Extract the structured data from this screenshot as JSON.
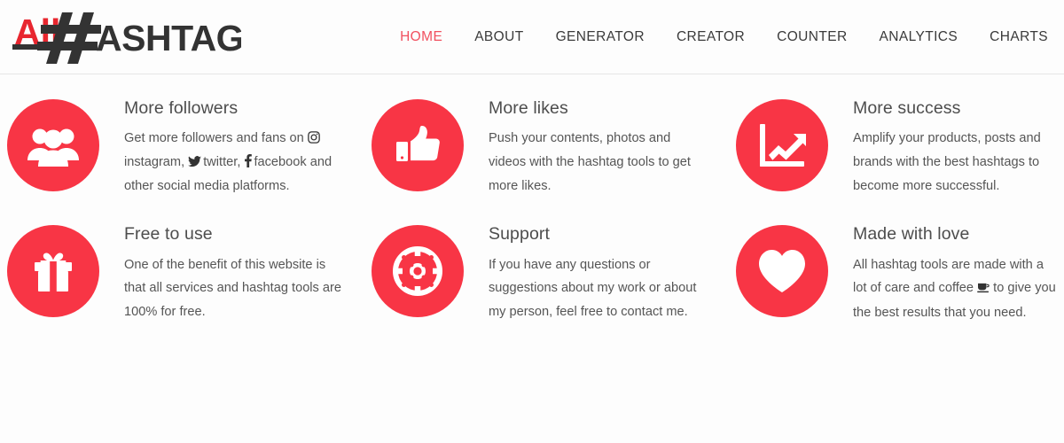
{
  "header": {
    "logo": {
      "name": "AllHashtag",
      "part_red": "All",
      "part_hash": "#",
      "part_dark": "ASHTAG"
    },
    "nav": [
      {
        "label": "HOME",
        "active": true
      },
      {
        "label": "ABOUT",
        "active": false
      },
      {
        "label": "GENERATOR",
        "active": false
      },
      {
        "label": "CREATOR",
        "active": false
      },
      {
        "label": "COUNTER",
        "active": false
      },
      {
        "label": "ANALYTICS",
        "active": false
      },
      {
        "label": "CHARTS",
        "active": false
      }
    ]
  },
  "colors": {
    "accent_red": "#f83545",
    "nav_active": "#f1505f",
    "logo_red": "#e8262f",
    "logo_dark": "#333333",
    "title_text": "#4d4d4d",
    "body_text": "#555555",
    "page_background": "#fdfdfd",
    "header_border": "#e6e6e6"
  },
  "features": [
    {
      "icon": "people-group-icon",
      "title": "More followers",
      "text_before": "Get more followers and fans on ",
      "inline_items": [
        {
          "icon": "instagram-icon",
          "label": "instagram,"
        },
        {
          "icon": "twitter-icon",
          "label": "twitter,"
        },
        {
          "icon": "facebook-icon",
          "label": "facebook"
        }
      ],
      "text_after": " and other social media platforms."
    },
    {
      "icon": "thumbs-up-icon",
      "title": "More likes",
      "text": "Push your contents, photos and videos with the hashtag tools to get more likes."
    },
    {
      "icon": "chart-growth-icon",
      "title": "More success",
      "text": "Amplify your products, posts and brands with the best hashtags to become more successful."
    },
    {
      "icon": "gift-box-icon",
      "title": "Free to use",
      "text": "One of the benefit of this website is that all services and hashtag tools are 100% for free."
    },
    {
      "icon": "life-buoy-icon",
      "title": "Support",
      "text": "If you have any questions or suggestions about my work or about my person, feel free to contact me."
    },
    {
      "icon": "heart-icon",
      "title": "Made with love",
      "text_before": "All hashtag tools are made with a lot of care and coffee ",
      "coffee_glyph": "☕",
      "text_after": " to give you the best results that you need."
    }
  ]
}
